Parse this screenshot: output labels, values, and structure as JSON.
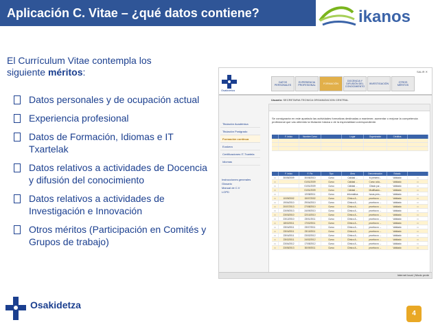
{
  "title": "Aplicación C. Vitae – ¿qué datos contiene?",
  "logos": {
    "ikanos": "ikanos",
    "osakidetza": "Osakidetza"
  },
  "intro": {
    "text": "El Currículum Vitae contempla los siguiente ",
    "bold": "méritos",
    "end": ":"
  },
  "bullets": [
    "Datos personales y de ocupación actual",
    "Experiencia profesional",
    "Datos de Formación, Idiomas e IT Txartelak",
    "Datos relativos a actividades de Docencia y difusión del conocimiento",
    "Datos relativos a actividades de Investigación e Innovación",
    "Otros méritos (Participación en Comités y Grupos de trabajo)"
  ],
  "page_number": "4",
  "colors": {
    "title_bar": "#2f5597",
    "text": "#1b3f8f",
    "accent": "#e9a825",
    "ikanos_green": "#7ab51d",
    "ikanos_blue": "#3a63a8"
  },
  "screenshot": {
    "logo_label": "Osakidetza",
    "user": "SALIR  ✕",
    "tabs": [
      {
        "label": "DATOS PERSONALES",
        "active": false
      },
      {
        "label": "EXPERIENCIA PROFESIONAL",
        "active": false
      },
      {
        "label": "FORMACIÓN",
        "active": true
      },
      {
        "label": "DOCENCIA Y DIFUSIÓN DEL CONOCIMIENTO",
        "active": false
      },
      {
        "label": "INVESTIGACIÓN",
        "active": false
      },
      {
        "label": "OTROS MÉRITOS",
        "active": false
      }
    ],
    "crumb_label": "Usuario:",
    "crumb_value": "SECRETARIA TECNICA ORGANIZACION CENTRAL",
    "side_items": [
      {
        "label": "Titulación Académica",
        "active": false
      },
      {
        "label": "Titulación Postgrado",
        "active": false
      },
      {
        "label": "Formación continua",
        "active": true
      },
      {
        "label": "Euskera",
        "active": false
      },
      {
        "label": "Certificaciones IT-Txartela",
        "active": false
      },
      {
        "label": "Idiomas",
        "active": false
      }
    ],
    "side_links": [
      "Instrucciones generales",
      "Glosario",
      "Manual de C.V",
      "LOPD"
    ],
    "paragraph": "Se consignarán en este apartado las actividades formativas destinadas a mantener, aumentar o mejorar la competencia profesional que vas obtenido la titulación básica o de la especialidad correspondiente.",
    "grid1_headers": [
      "",
      "F. Inicio",
      "Nombre Curso",
      "",
      "Lugar",
      "Organizador",
      "Créditos",
      ""
    ],
    "grid2_headers": [
      "",
      "F. Inicio",
      "F. Fin",
      "Tipo",
      "Área",
      "Denominación",
      "Estado",
      ""
    ],
    "rows": [
      [
        "30/05/2009",
        "30/05/2010",
        "Curso",
        "Calidad ...",
        "fo presenc...",
        "Validado"
      ],
      [
        "",
        "01/01/2009",
        "Curso",
        "Calidad ...",
        "Curso cola...",
        "Validado"
      ],
      [
        "",
        "01/01/2009",
        "Curso",
        "Calidad ...",
        "Citado pur...",
        "Validado"
      ],
      [
        "",
        "01/01/2009",
        "Curso",
        "Calidad ...",
        "Modificado...",
        "Validado"
      ],
      [
        "",
        "12/08/2011",
        "Curso",
        "Informática",
        "horas pres...",
        "Validado"
      ],
      [
        "10/09/2002",
        "15/07/2002",
        "Curso",
        "Clínico A...",
        "prueba no ...",
        "Validado"
      ],
      [
        "19/04/2010",
        "29/04/2010",
        "Curso",
        "Clínico A...",
        "prueba no ...",
        "Validado"
      ],
      [
        "20/07/2013",
        "27/08/2010",
        "Curso",
        "Clínico A...",
        "prueba no ...",
        "Validado"
      ],
      [
        "23/09/2013",
        "24/09/2010",
        "Curso",
        "Clínico A...",
        "prueba no ...",
        "Validado"
      ],
      [
        "23/03/2010",
        "22/10/2010",
        "Curso",
        "Clínico A...",
        "prueba no ...",
        "Validado"
      ],
      [
        "23/12/2010",
        "23/01/2011",
        "Curso",
        "Clínico A...",
        "prueba no ...",
        "Validado"
      ],
      [
        "18/02/2011",
        "17/02/2011",
        "Curso",
        "Clínico A...",
        "prueba no ...",
        "Validado"
      ],
      [
        "23/04/2011",
        "23/07/2011",
        "Curso",
        "Clínico A...",
        "prueba no ...",
        "Validado"
      ],
      [
        "23/04/2011",
        "23/10/2011",
        "Curso",
        "Clínico A...",
        "prueba no ...",
        "Validado"
      ],
      [
        "23/04/2011",
        "23/02/2012",
        "Curso",
        "Clínico A...",
        "prueba no ...",
        "Validado"
      ],
      [
        "23/02/2011",
        "24/02/2012",
        "Curso",
        "Clínico A...",
        "prueba no ...",
        "Validado"
      ],
      [
        "23/04/2012",
        "17/05/2012",
        "Curso",
        "Clínico A...",
        "prueba no ...",
        "Validado"
      ],
      [
        "23/05/2013",
        "30/09/2011",
        "Curso",
        "Clínico A...",
        "prueba no ...",
        "Validado"
      ]
    ],
    "status_text": "Internet local | Modo prote"
  }
}
